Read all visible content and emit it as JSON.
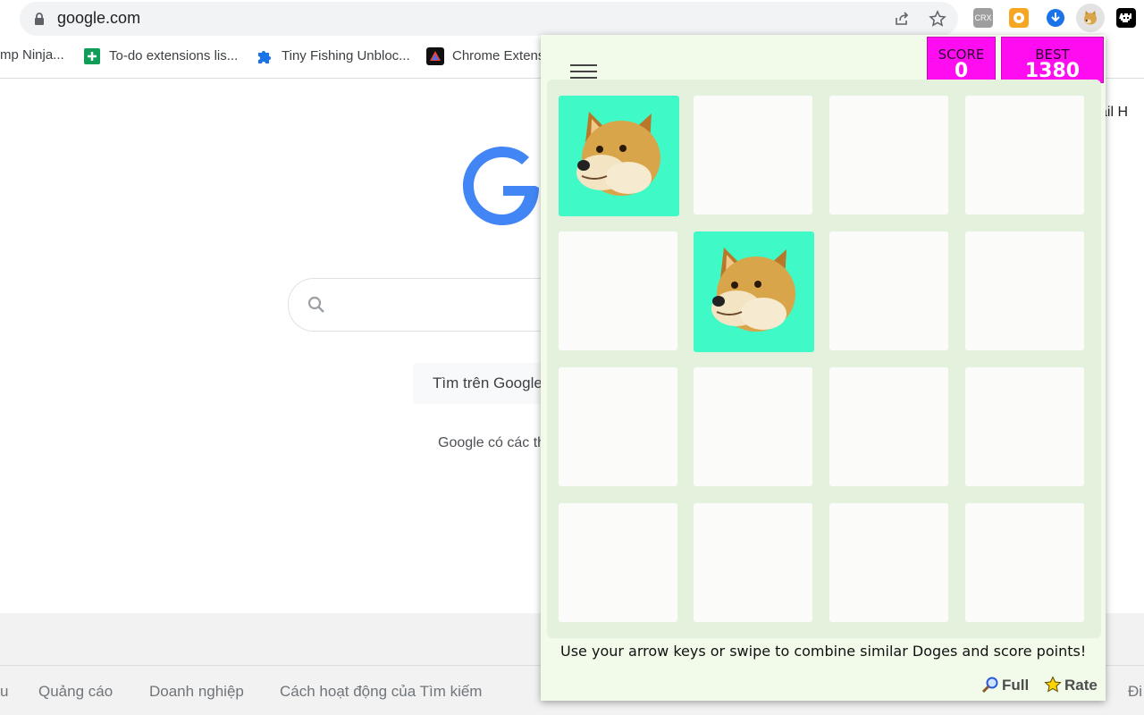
{
  "browser": {
    "url": "google.com",
    "extensions": [
      "crx-icon",
      "settings-gear-extension-icon",
      "download-extension-icon",
      "doge-extension-icon",
      "space-invader-extension-icon"
    ]
  },
  "bookmarks": [
    {
      "label": "mp Ninja...",
      "icon": "none"
    },
    {
      "label": "To-do extensions lis...",
      "icon": "sheets-icon"
    },
    {
      "label": "Tiny Fishing Unbloc...",
      "icon": "puzzle-icon"
    },
    {
      "label": "Chrome Extens",
      "icon": "triangle-logo-icon"
    }
  ],
  "google": {
    "search_button": "Tìm trên Google",
    "offered_text": "Google có các th",
    "top_right": "ail   H",
    "footer_links": [
      "u",
      "Quảng cáo",
      "Doanh nghiệp",
      "Cách hoạt động của Tìm kiếm",
      "Đi"
    ]
  },
  "popup": {
    "score_label": "SCORE",
    "score_value": "0",
    "best_label": "BEST",
    "best_value": "1380",
    "instructions": "Use your arrow keys or swipe to combine similar Doges and score points!",
    "full_label": "Full",
    "rate_label": "Rate",
    "board": [
      [
        "doge",
        "",
        "",
        ""
      ],
      [
        "",
        "doge",
        "",
        ""
      ],
      [
        "",
        "",
        "",
        ""
      ],
      [
        "",
        "",
        "",
        ""
      ]
    ]
  },
  "colors": {
    "popup_bg": "#f2fbea",
    "score_bg": "#ff0df0",
    "doge_tile": "#3ffac6",
    "board_bg": "#e4f2dd"
  }
}
